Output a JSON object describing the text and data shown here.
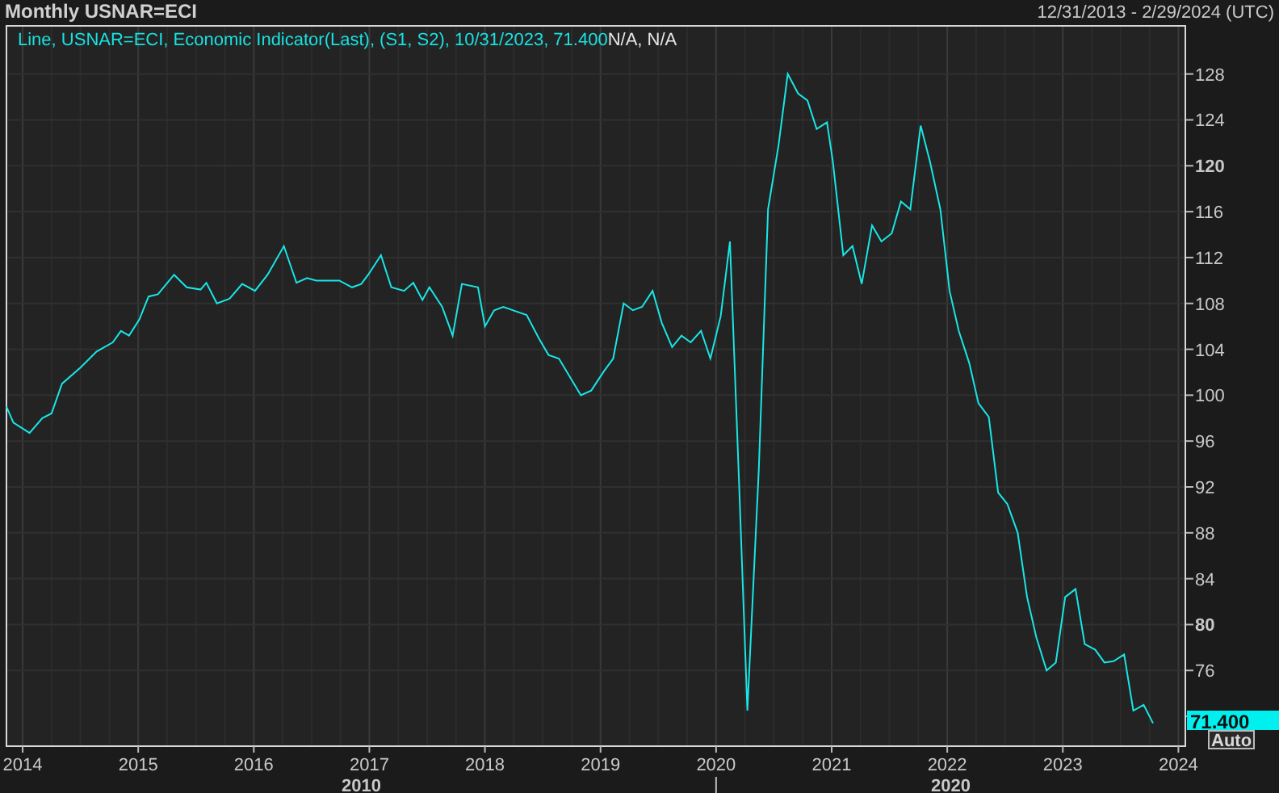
{
  "header": {
    "title": "Monthly USNAR=ECI",
    "date_range": "12/31/2013 - 2/29/2024 (UTC)"
  },
  "legend": {
    "text": "Line, USNAR=ECI, Economic Indicator(Last), (S1, S2),  10/31/2023, 71.400",
    "suffix": "N/A, N/A"
  },
  "chart": {
    "price_tag": "71.400",
    "scale_button": "Auto",
    "decade_labels": [
      {
        "label": "2010"
      },
      {
        "label": "2020"
      }
    ],
    "chart_data": {
      "type": "line",
      "grid": true,
      "xlim": [
        2013.86,
        2024.06
      ],
      "ylim": [
        69.4,
        132.2
      ],
      "xticks": [
        2014,
        2015,
        2016,
        2017,
        2018,
        2019,
        2020,
        2021,
        2022,
        2023,
        2024
      ],
      "yticks": [
        76,
        80,
        84,
        88,
        92,
        96,
        100,
        104,
        108,
        112,
        116,
        120,
        124,
        128
      ],
      "series": [
        {
          "color": "#19e6e6",
          "x": [
            2013.86,
            2013.92,
            2014.06,
            2014.17,
            2014.25,
            2014.34,
            2014.5,
            2014.64,
            2014.78,
            2014.85,
            2014.92,
            2015.01,
            2015.09,
            2015.17,
            2015.31,
            2015.42,
            2015.54,
            2015.59,
            2015.68,
            2015.79,
            2015.9,
            2016.01,
            2016.12,
            2016.26,
            2016.37,
            2016.46,
            2016.54,
            2016.74,
            2016.85,
            2016.93,
            2016.99,
            2017.1,
            2017.19,
            2017.3,
            2017.38,
            2017.46,
            2017.52,
            2017.63,
            2017.72,
            2017.8,
            2017.94,
            2018.0,
            2018.08,
            2018.16,
            2018.27,
            2018.36,
            2018.47,
            2018.55,
            2018.64,
            2018.83,
            2018.92,
            2019.03,
            2019.11,
            2019.2,
            2019.28,
            2019.36,
            2019.45,
            2019.53,
            2019.62,
            2019.7,
            2019.78,
            2019.87,
            2019.95,
            2020.04,
            2020.12,
            2020.2,
            2020.27,
            2020.37,
            2020.45,
            2020.54,
            2020.62,
            2020.71,
            2020.79,
            2020.87,
            2020.96,
            2021.01,
            2021.1,
            2021.18,
            2021.26,
            2021.35,
            2021.43,
            2021.52,
            2021.6,
            2021.68,
            2021.77,
            2021.85,
            2021.94,
            2022.02,
            2022.1,
            2022.19,
            2022.27,
            2022.36,
            2022.44,
            2022.52,
            2022.61,
            2022.69,
            2022.77,
            2022.86,
            2022.94,
            2023.02,
            2023.11,
            2023.19,
            2023.28,
            2023.36,
            2023.44,
            2023.53,
            2023.61,
            2023.7,
            2023.78
          ],
          "values": [
            99.0,
            97.6,
            96.7,
            98.0,
            98.4,
            101.0,
            102.4,
            103.8,
            104.6,
            105.6,
            105.2,
            106.6,
            108.6,
            108.8,
            110.5,
            109.4,
            109.2,
            109.8,
            108.0,
            108.4,
            109.7,
            109.1,
            110.5,
            113.0,
            109.8,
            110.2,
            110.0,
            110.0,
            109.4,
            109.7,
            110.5,
            112.2,
            109.4,
            109.1,
            109.8,
            108.3,
            109.4,
            107.7,
            105.2,
            109.7,
            109.4,
            106.0,
            107.4,
            107.7,
            107.3,
            107.0,
            104.9,
            103.5,
            103.2,
            100.0,
            100.4,
            102.1,
            103.2,
            108.0,
            107.4,
            107.7,
            109.1,
            106.3,
            104.2,
            105.2,
            104.6,
            105.6,
            103.2,
            106.9,
            113.4,
            92.2,
            72.5,
            93.6,
            116.2,
            121.8,
            128.0,
            126.3,
            125.7,
            123.2,
            123.8,
            120.4,
            112.2,
            113.0,
            109.7,
            114.8,
            113.4,
            114.1,
            116.9,
            116.2,
            123.5,
            120.4,
            116.2,
            109.1,
            105.6,
            102.8,
            99.3,
            98.1,
            91.5,
            90.5,
            88.0,
            82.4,
            78.9,
            76.0,
            76.7,
            82.4,
            83.1,
            78.3,
            77.8,
            76.7,
            76.8,
            77.4,
            72.5,
            73.0,
            71.4
          ]
        }
      ]
    }
  }
}
